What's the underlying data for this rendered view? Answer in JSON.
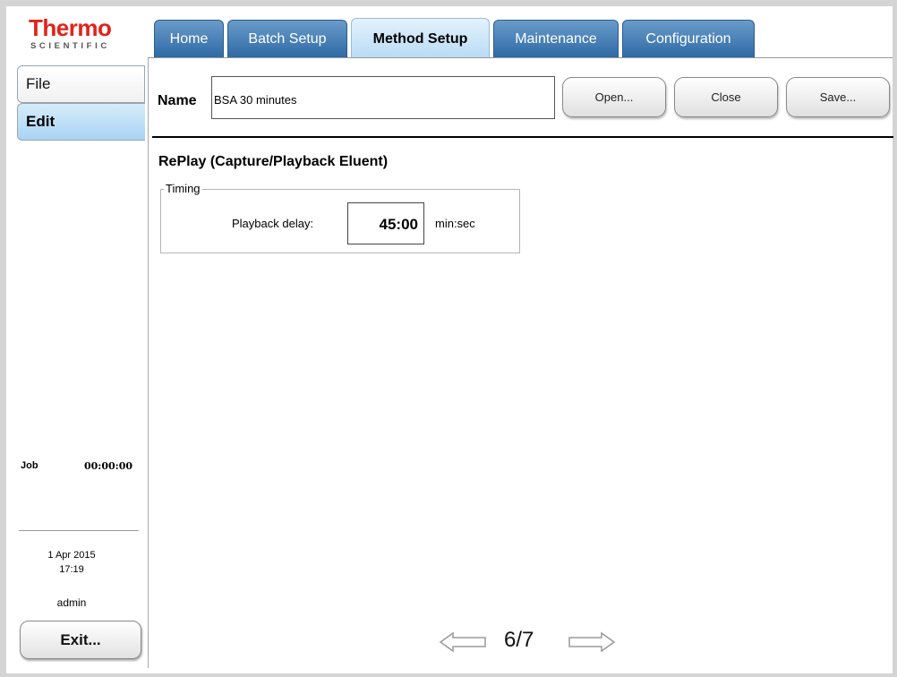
{
  "brand": {
    "name": "Thermo",
    "sub": "SCIENTIFIC",
    "color": "#e2231a"
  },
  "tabs": [
    {
      "label": "Home",
      "active": false
    },
    {
      "label": "Batch Setup",
      "active": false
    },
    {
      "label": "Method Setup",
      "active": true
    },
    {
      "label": "Maintenance",
      "active": false
    },
    {
      "label": "Configuration",
      "active": false
    }
  ],
  "sidebar": {
    "file_label": "File",
    "edit_label": "Edit",
    "job_label": "Job",
    "job_time": "00:00:00",
    "date": "1 Apr 2015",
    "time": "17:19",
    "user": "admin",
    "exit_label": "Exit..."
  },
  "method": {
    "name_label": "Name",
    "name_value": "BSA 30 minutes",
    "open_label": "Open...",
    "close_label": "Close",
    "save_label": "Save..."
  },
  "section": {
    "title": "RePlay (Capture/Playback Eluent)",
    "group_label": "Timing",
    "playback_label": "Playback delay:",
    "playback_value": "45:00",
    "playback_unit": "min:sec"
  },
  "pager": {
    "indicator": "6/7"
  },
  "colors": {
    "tab": "#2e6aa6",
    "tab_active": "#b8dcf5",
    "accent": "#e2231a"
  }
}
